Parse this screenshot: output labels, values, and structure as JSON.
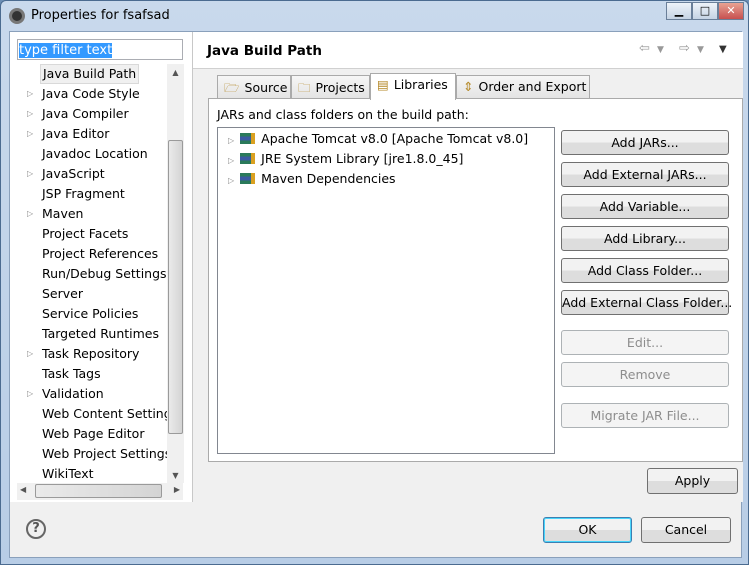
{
  "window": {
    "title": "Properties for fsafsad"
  },
  "filter": {
    "value": "type filter text"
  },
  "sidebar": {
    "items": [
      {
        "label": "Java Build Path",
        "expandable": false,
        "selected": true
      },
      {
        "label": "Java Code Style",
        "expandable": true
      },
      {
        "label": "Java Compiler",
        "expandable": true
      },
      {
        "label": "Java Editor",
        "expandable": true
      },
      {
        "label": "Javadoc Location",
        "expandable": false
      },
      {
        "label": "JavaScript",
        "expandable": true
      },
      {
        "label": "JSP Fragment",
        "expandable": false
      },
      {
        "label": "Maven",
        "expandable": true
      },
      {
        "label": "Project Facets",
        "expandable": false
      },
      {
        "label": "Project References",
        "expandable": false
      },
      {
        "label": "Run/Debug Settings",
        "expandable": false
      },
      {
        "label": "Server",
        "expandable": false
      },
      {
        "label": "Service Policies",
        "expandable": false
      },
      {
        "label": "Targeted Runtimes",
        "expandable": false
      },
      {
        "label": "Task Repository",
        "expandable": true
      },
      {
        "label": "Task Tags",
        "expandable": false
      },
      {
        "label": "Validation",
        "expandable": true
      },
      {
        "label": "Web Content Settings",
        "expandable": false
      },
      {
        "label": "Web Page Editor",
        "expandable": false
      },
      {
        "label": "Web Project Settings",
        "expandable": false
      },
      {
        "label": "WikiText",
        "expandable": false
      }
    ]
  },
  "page": {
    "title": "Java Build Path"
  },
  "tabs": [
    {
      "label": "Source",
      "icon": "source-folder-icon"
    },
    {
      "label": "Projects",
      "icon": "folder-icon"
    },
    {
      "label": "Libraries",
      "icon": "library-icon",
      "active": true
    },
    {
      "label": "Order and Export",
      "icon": "order-export-icon"
    }
  ],
  "panel": {
    "label": "JARs and class folders on the build path:",
    "entries": [
      "Apache Tomcat v8.0 [Apache Tomcat v8.0]",
      "JRE System Library [jre1.8.0_45]",
      "Maven Dependencies"
    ]
  },
  "buttons": [
    {
      "label": "Add JARs...",
      "enabled": true
    },
    {
      "label": "Add External JARs...",
      "enabled": true
    },
    {
      "label": "Add Variable...",
      "enabled": true
    },
    {
      "label": "Add Library...",
      "enabled": true
    },
    {
      "label": "Add Class Folder...",
      "enabled": true
    },
    {
      "label": "Add External Class Folder...",
      "enabled": true
    },
    {
      "label": "Edit...",
      "enabled": false
    },
    {
      "label": "Remove",
      "enabled": false
    },
    {
      "label": "Migrate JAR File...",
      "enabled": false
    }
  ],
  "footer": {
    "apply": "Apply",
    "ok": "OK",
    "cancel": "Cancel",
    "help": "?"
  }
}
